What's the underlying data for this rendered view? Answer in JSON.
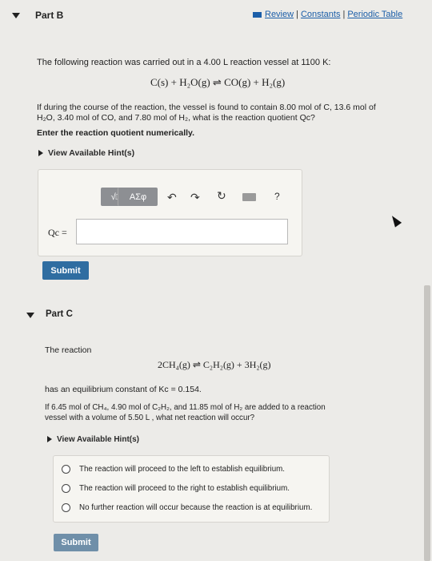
{
  "header": {
    "part_label": "Part B",
    "links": [
      "Review",
      "Constants",
      "Periodic Table"
    ]
  },
  "partB": {
    "intro": "The following reaction was carried out in a 4.00 L reaction vessel at 1100 K:",
    "equation": "C(s) + H₂O(g) ⇌ CO(g) + H₂(g)",
    "question_line1": "If during the course of the reaction, the vessel is found to contain 8.00 mol of C, 13.6 mol of",
    "question_line2": "H₂O, 3.40 mol of CO, and 7.80 mol of H₂, what is the reaction quotient Qc?",
    "instruction": "Enter the reaction quotient numerically.",
    "hint_label": "View Available Hint(s)",
    "toolbar": {
      "template_label": "√□",
      "greek_label": "AΣφ",
      "help_label": "?"
    },
    "input_label": "Qc =",
    "input_value": "",
    "submit_label": "Submit"
  },
  "partC": {
    "part_label": "Part C",
    "intro": "The reaction",
    "equation": "2CH₄(g) ⇌ C₂H₂(g) + 3H₂(g)",
    "kc_text": "has an equilibrium constant of Kc = 0.154.",
    "question_line1": "If 6.45 mol of CH₄, 4.90 mol of C₂H₂, and 11.85 mol of H₂ are added to a reaction",
    "question_line2": "vessel with a volume of 5.50 L , what net reaction will occur?",
    "hint_label": "View Available Hint(s)",
    "options": [
      "The reaction will proceed to the left to establish equilibrium.",
      "The reaction will proceed to the right to establish equilibrium.",
      "No further reaction will occur because the reaction is at equilibrium."
    ],
    "submit_label": "Submit"
  },
  "colors": {
    "link": "#1b5ea8",
    "submit": "#2f6da1",
    "background": "#ecebe8"
  }
}
